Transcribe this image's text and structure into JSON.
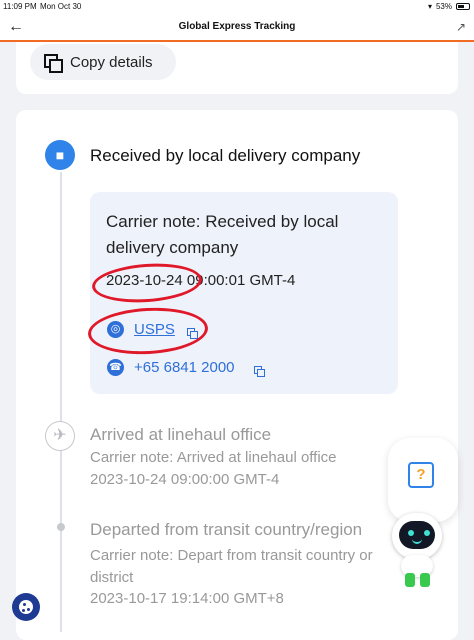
{
  "status_bar": {
    "time": "11:09 PM",
    "date": "Mon Oct 30",
    "battery": "53%"
  },
  "nav": {
    "title": "Global Express Tracking"
  },
  "copy_details": {
    "label": "Copy details"
  },
  "events": [
    {
      "title": "Received by local delivery company",
      "note": "Carrier note: Received by local delivery company",
      "datetime": "2023-10-24 09:00:01 GMT-4",
      "carrier_link": "USPS",
      "phone": "+65 6841 2000",
      "icon": "truck-icon"
    },
    {
      "title": "Arrived at linehaul office",
      "note": "Carrier note: Arrived at linehaul office",
      "datetime": "2023-10-24 09:00:00 GMT-4",
      "icon": "airplane-icon"
    },
    {
      "title": "Departed from transit country/region",
      "note": "Carrier note: Depart from transit country or district",
      "datetime": "2023-10-17 19:14:00 GMT+8"
    }
  ],
  "colors": {
    "accent": "#2f83e9",
    "nav_underline": "#f26b22",
    "annotation": "#e0192a"
  }
}
